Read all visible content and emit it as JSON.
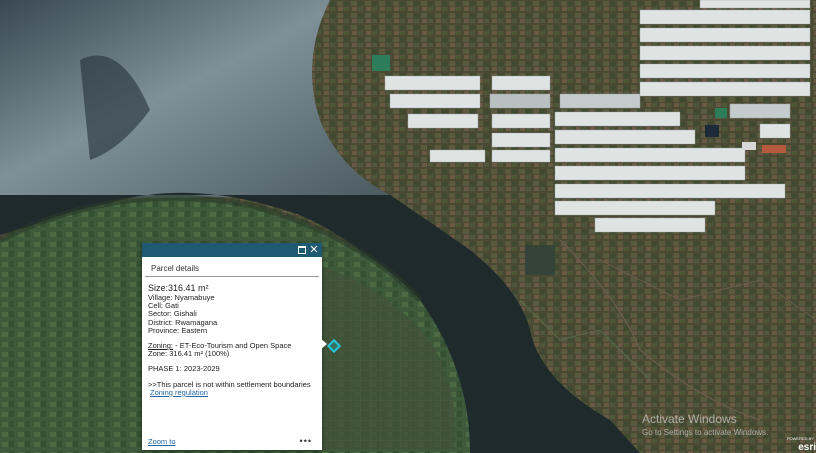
{
  "popup": {
    "title": "Parcel details",
    "size": "Size:316.41 m²",
    "village": "Village: Nyamabuye",
    "cell": "Cell: Gati",
    "sector": "Sector: Gishali",
    "district": "District: Rwamagana",
    "province": "Province: Eastern",
    "zoning_label": "Zoning:",
    "zoning_value": " - ET-Eco-Tourism and Open Space",
    "zone": "Zone: 316.41 m² (100%)",
    "phase": "PHASE 1: 2023-2029",
    "settlement_note": ">>This parcel is not within settlement boundaries",
    "zoning_regulation_link": "Zoning regulation",
    "zoom_to": "Zoom to",
    "more": "•••",
    "maximize_icon": "maximize-icon",
    "close_icon": "close-icon",
    "header_color": "#1f5a72"
  },
  "watermark": {
    "title": "Activate Windows",
    "subtitle": "Go to Settings to activate Windows."
  },
  "attribution": {
    "powered": "POWERED BY",
    "logo": "esri"
  },
  "colors": {
    "water": "#1f2a2c",
    "lake_light": "#8a9ba0",
    "vegetation": "#3f5a3a",
    "greenhouse": "#dfe3e2",
    "marker": "#26c6da"
  }
}
